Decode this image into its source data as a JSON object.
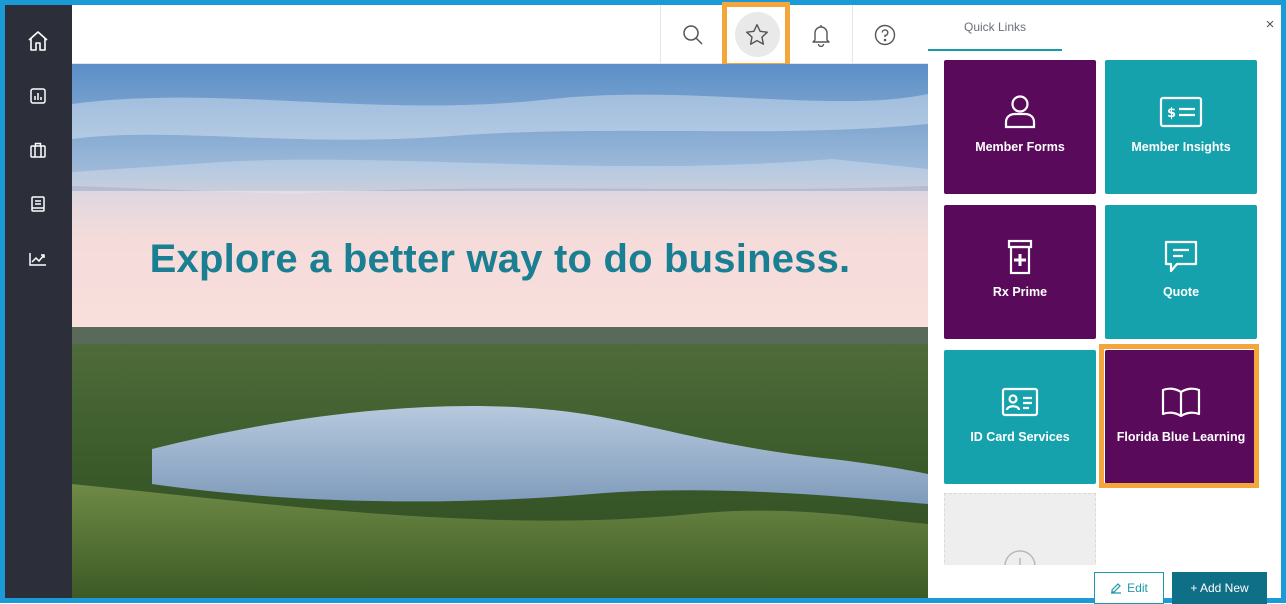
{
  "hero": {
    "headline": "Explore a better way to do business."
  },
  "sidebar": {
    "items": [
      {
        "icon": "home-icon"
      },
      {
        "icon": "bar-chart-icon"
      },
      {
        "icon": "briefcase-icon"
      },
      {
        "icon": "book-icon"
      },
      {
        "icon": "trend-chart-icon"
      }
    ]
  },
  "topbar": {
    "icons": [
      "search-icon",
      "star-icon",
      "bell-icon",
      "help-icon"
    ],
    "active": "star-icon"
  },
  "quick_links": {
    "tab_label": "Quick Links",
    "close_label": "×",
    "tiles": [
      {
        "label": "Member Forms",
        "icon": "user-icon",
        "color": "#5a0a5a"
      },
      {
        "label": "Member Insights",
        "icon": "dollar-card-icon",
        "color": "#16a2ad"
      },
      {
        "label": "Rx Prime",
        "icon": "pill-bottle-icon",
        "color": "#5a0a5a"
      },
      {
        "label": "Quote",
        "icon": "chat-icon",
        "color": "#16a2ad"
      },
      {
        "label": "ID Card Services",
        "icon": "id-card-icon",
        "color": "#16a2ad"
      },
      {
        "label": "Florida Blue Learning",
        "icon": "open-book-icon",
        "color": "#5a0a5a"
      }
    ],
    "edit_label": "Edit",
    "add_label": "+ Add New"
  },
  "colors": {
    "frame": "#1a9ad6",
    "highlight": "#f4a63c",
    "sidebar": "#2c2f3a",
    "purple": "#5a0a5a",
    "teal": "#16a2ad",
    "headline": "#1a7f92"
  }
}
